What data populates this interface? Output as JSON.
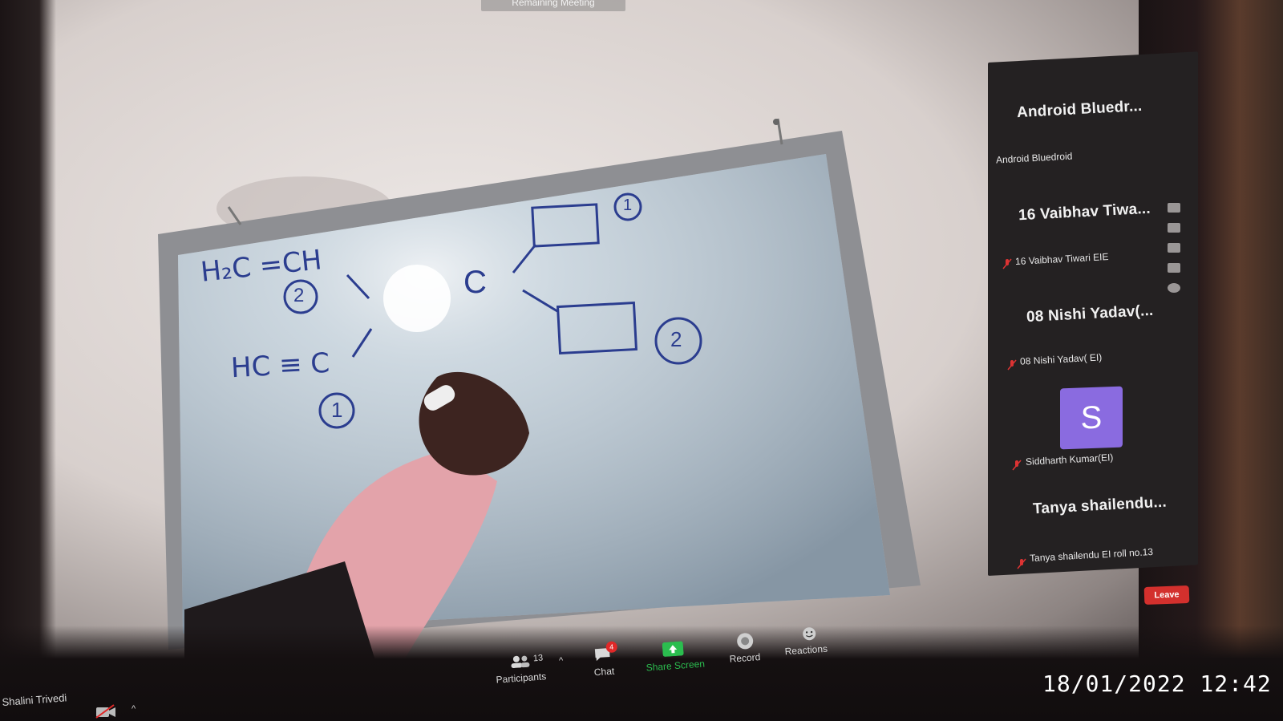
{
  "meeting": {
    "remaining_label": "Remaining Meeting"
  },
  "whiteboard": {
    "eq_top": "H₂C =CH",
    "eq_top_num": "2",
    "eq_bottom": "HC ≡ C",
    "eq_bottom_num": "1",
    "center_atom": "C",
    "box1_num": "1",
    "box2_num": "2"
  },
  "participants_panel": {
    "tiles": [
      {
        "display_name": "Android Bluedr...",
        "full_name": "Android Bluedroid",
        "muted": false
      },
      {
        "display_name": "16 Vaibhav Tiwa...",
        "full_name": "16 Vaibhav Tiwari EIE",
        "muted": true
      },
      {
        "display_name": "08 Nishi Yadav(...",
        "full_name": "08 Nishi Yadav( EI)",
        "muted": true
      },
      {
        "display_name": "",
        "avatar_letter": "S",
        "avatar_color": "#8a6be0",
        "full_name": "Siddharth Kumar(EI)",
        "muted": true
      },
      {
        "display_name": "Tanya shailendu...",
        "full_name": "Tanya shailendu EI roll no.13",
        "muted": true
      }
    ],
    "side_icons": [
      "hand-icon",
      "camera-icon",
      "video-icon",
      "image-icon",
      "settings-icon"
    ]
  },
  "toolbar": {
    "participants_count": "13",
    "participants_label": "Participants",
    "chat_label": "Chat",
    "chat_badge": "4",
    "share_label": "Share Screen",
    "record_label": "Record",
    "reactions_label": "Reactions",
    "leave_label": "Leave",
    "self_name": "Shalini Trivedi",
    "share_color": "#2bbd4f",
    "leave_color": "#d3302d"
  },
  "overlay": {
    "timestamp": "18/01/2022 12:42"
  }
}
